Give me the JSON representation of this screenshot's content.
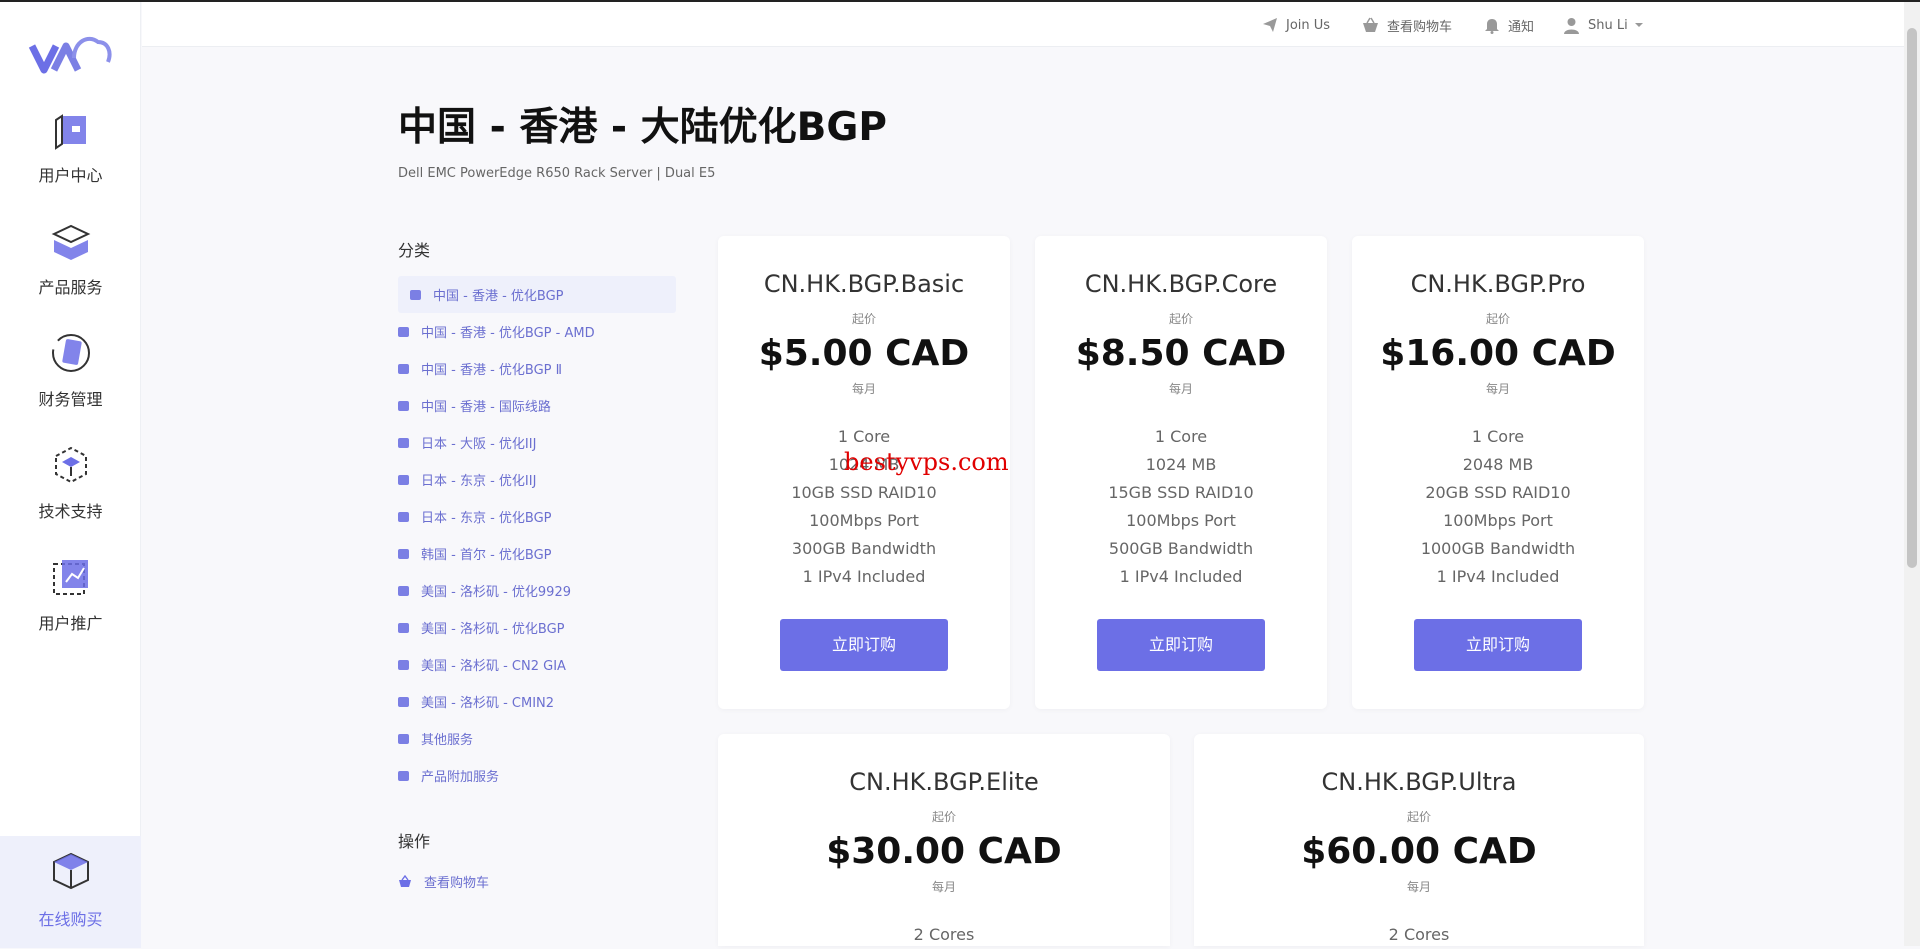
{
  "colors": {
    "accent": "#6c6fe6",
    "watermark": "#e00000"
  },
  "logo": {
    "name": "va-cloud-logo"
  },
  "rail": {
    "items": [
      {
        "label": "用户中心",
        "icon": "user-center-icon"
      },
      {
        "label": "产品服务",
        "icon": "product-service-icon"
      },
      {
        "label": "财务管理",
        "icon": "finance-icon"
      },
      {
        "label": "技术支持",
        "icon": "support-icon"
      },
      {
        "label": "用户推广",
        "icon": "promotion-icon"
      }
    ],
    "bottom": {
      "label": "在线购买",
      "icon": "cube-icon"
    }
  },
  "header": {
    "join_us": "Join Us",
    "cart": "查看购物车",
    "notify": "通知",
    "user": "Shu Li"
  },
  "page": {
    "title": "中国 - 香港 - 大陆优化BGP",
    "subtitle": "Dell EMC PowerEdge R650 Rack Server | Dual E5"
  },
  "sidebar": {
    "categories_title": "分类",
    "categories": [
      "中国 - 香港 - 优化BGP",
      "中国 - 香港 - 优化BGP - AMD",
      "中国 - 香港 - 优化BGP Ⅱ",
      "中国 - 香港 - 国际线路",
      "日本 - 大阪 - 优化IIJ",
      "日本 - 东京 - 优化IIJ",
      "日本 - 东京 - 优化BGP",
      "韩国 - 首尔 - 优化BGP",
      "美国 - 洛杉矶 - 优化9929",
      "美国 - 洛杉矶 - 优化BGP",
      "美国 - 洛杉矶 - CN2 GIA",
      "美国 - 洛杉矶 - CMIN2",
      "其他服务",
      "产品附加服务"
    ],
    "active_index": 0,
    "actions_title": "操作",
    "actions": [
      "查看购物车"
    ]
  },
  "products": [
    {
      "name": "CN.HK.BGP.Basic",
      "from": "起价",
      "price": "$5.00 CAD",
      "period": "每月",
      "specs": [
        "1 Core",
        "1024 MB",
        "10GB SSD RAID10",
        "100Mbps Port",
        "300GB Bandwidth",
        "1 IPv4 Included"
      ],
      "button": "立即订购"
    },
    {
      "name": "CN.HK.BGP.Core",
      "from": "起价",
      "price": "$8.50 CAD",
      "period": "每月",
      "specs": [
        "1 Core",
        "1024 MB",
        "15GB SSD RAID10",
        "100Mbps Port",
        "500GB Bandwidth",
        "1 IPv4 Included"
      ],
      "button": "立即订购"
    },
    {
      "name": "CN.HK.BGP.Pro",
      "from": "起价",
      "price": "$16.00 CAD",
      "period": "每月",
      "specs": [
        "1 Core",
        "2048 MB",
        "20GB SSD RAID10",
        "100Mbps Port",
        "1000GB Bandwidth",
        "1 IPv4 Included"
      ],
      "button": "立即订购"
    },
    {
      "name": "CN.HK.BGP.Elite",
      "from": "起价",
      "price": "$30.00 CAD",
      "period": "每月",
      "specs": [
        "2 Cores"
      ]
    },
    {
      "name": "CN.HK.BGP.Ultra",
      "from": "起价",
      "price": "$60.00 CAD",
      "period": "每月",
      "specs": [
        "2 Cores"
      ]
    }
  ],
  "watermark": "bestyvps.com"
}
